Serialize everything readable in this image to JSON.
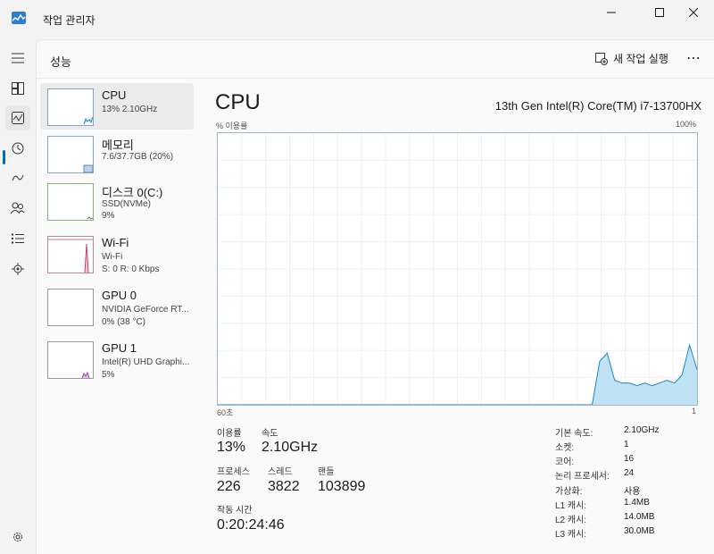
{
  "window": {
    "title": "작업 관리자"
  },
  "header": {
    "page_title": "성능",
    "run_task_label": "새 작업 실행",
    "more_label": "⋯"
  },
  "nav": {
    "items": [
      "menu-icon",
      "processes-icon",
      "performance-icon",
      "app-history-icon",
      "startup-icon",
      "users-icon",
      "details-icon",
      "services-icon"
    ],
    "settings": "settings-icon"
  },
  "devices": [
    {
      "name": "CPU",
      "sub1": "13% 2.10GHz",
      "sub2": ""
    },
    {
      "name": "메모리",
      "sub1": "7.6/37.7GB (20%)",
      "sub2": ""
    },
    {
      "name": "디스크 0(C:)",
      "sub1": "SSD(NVMe)",
      "sub2": "9%"
    },
    {
      "name": "Wi-Fi",
      "sub1": "Wi-Fi",
      "sub2": "S: 0 R: 0 Kbps"
    },
    {
      "name": "GPU 0",
      "sub1": "NVIDIA GeForce RT...",
      "sub2": "0% (38 °C)"
    },
    {
      "name": "GPU 1",
      "sub1": "Intel(R) UHD Graphi...",
      "sub2": "5%"
    }
  ],
  "detail": {
    "title": "CPU",
    "model": "13th Gen Intel(R) Core(TM) i7-13700HX",
    "axis_top_left": "% 이용률",
    "axis_top_right": "100%",
    "axis_bottom_left": "60초",
    "axis_bottom_right": "1",
    "graph_color": "#bfe3f5",
    "graph_line": "#1a86c9",
    "usage": [
      0,
      0,
      0,
      0,
      0,
      0,
      0,
      0,
      0,
      0,
      0,
      0,
      0,
      0,
      0,
      0,
      0,
      0,
      0,
      0,
      0,
      0,
      0,
      0,
      0,
      0,
      0,
      0,
      0,
      0,
      0,
      0,
      0,
      0,
      0,
      0,
      0,
      0,
      0,
      0,
      0,
      0,
      0,
      0,
      0,
      0,
      0,
      0,
      0,
      0,
      0,
      16,
      19,
      9,
      8,
      8,
      7,
      8,
      7,
      8,
      9,
      8,
      11,
      22,
      13
    ],
    "stats": {
      "util_label": "이용률",
      "util_value": "13%",
      "speed_label": "속도",
      "speed_value": "2.10GHz",
      "proc_label": "프로세스",
      "proc_value": "226",
      "thread_label": "스레드",
      "thread_value": "3822",
      "handle_label": "핸들",
      "handle_value": "103899",
      "uptime_label": "작동 시간",
      "uptime_value": "0:20:24:46"
    },
    "specs": [
      {
        "k": "기본 속도:",
        "v": "2.10GHz"
      },
      {
        "k": "소켓:",
        "v": "1"
      },
      {
        "k": "코어:",
        "v": "16"
      },
      {
        "k": "논리 프로세서:",
        "v": "24"
      },
      {
        "k": "가상화:",
        "v": "사용"
      },
      {
        "k": "L1 캐시:",
        "v": "1.4MB"
      },
      {
        "k": "L2 캐시:",
        "v": "14.0MB"
      },
      {
        "k": "L3 캐시:",
        "v": "30.0MB"
      }
    ]
  }
}
